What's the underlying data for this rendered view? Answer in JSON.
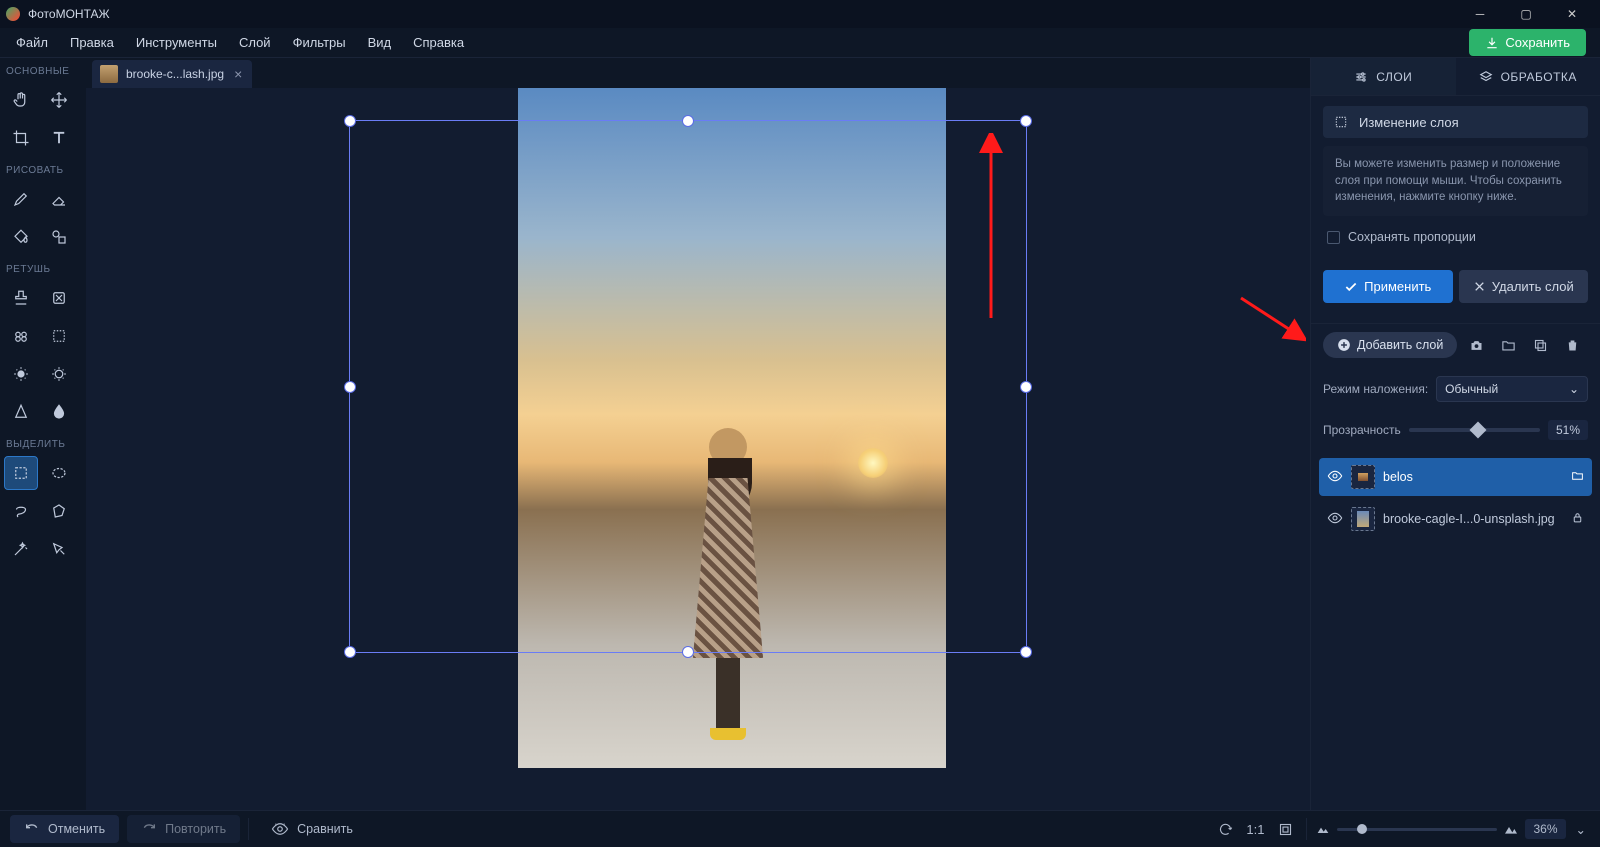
{
  "title": "ФотоМОНТАЖ",
  "menu": [
    "Файл",
    "Правка",
    "Инструменты",
    "Слой",
    "Фильтры",
    "Вид",
    "Справка"
  ],
  "save_btn": "Сохранить",
  "tab": {
    "filename": "brooke-c...lash.jpg"
  },
  "toolbox_groups": {
    "g1": "ОСНОВНЫЕ",
    "g2": "РИСОВАТЬ",
    "g3": "РЕТУШЬ",
    "g4": "ВЫДЕЛИТЬ"
  },
  "right": {
    "tabs": {
      "layers": "СЛОИ",
      "process": "ОБРАБОТКА"
    },
    "layer_change": "Изменение слоя",
    "hint": "Вы можете изменить размер и положение слоя при помощи мыши. Чтобы сохранить изменения, нажмите кнопку ниже.",
    "keep_ratio": "Сохранять пропорции",
    "apply": "Применить",
    "delete_layer": "Удалить слой",
    "add_layer": "Добавить слой",
    "blend_label": "Режим наложения:",
    "blend_value": "Обычный",
    "opacity_label": "Прозрачность",
    "opacity_value": "51%",
    "layers": [
      {
        "name": "belos",
        "selected": true,
        "folder": true
      },
      {
        "name": "brooke-cagle-I...0-unsplash.jpg",
        "selected": false,
        "locked": true
      }
    ]
  },
  "bottom": {
    "undo": "Отменить",
    "redo": "Повторить",
    "compare": "Сравнить",
    "ratio": "1:1",
    "zoom": "36%"
  }
}
